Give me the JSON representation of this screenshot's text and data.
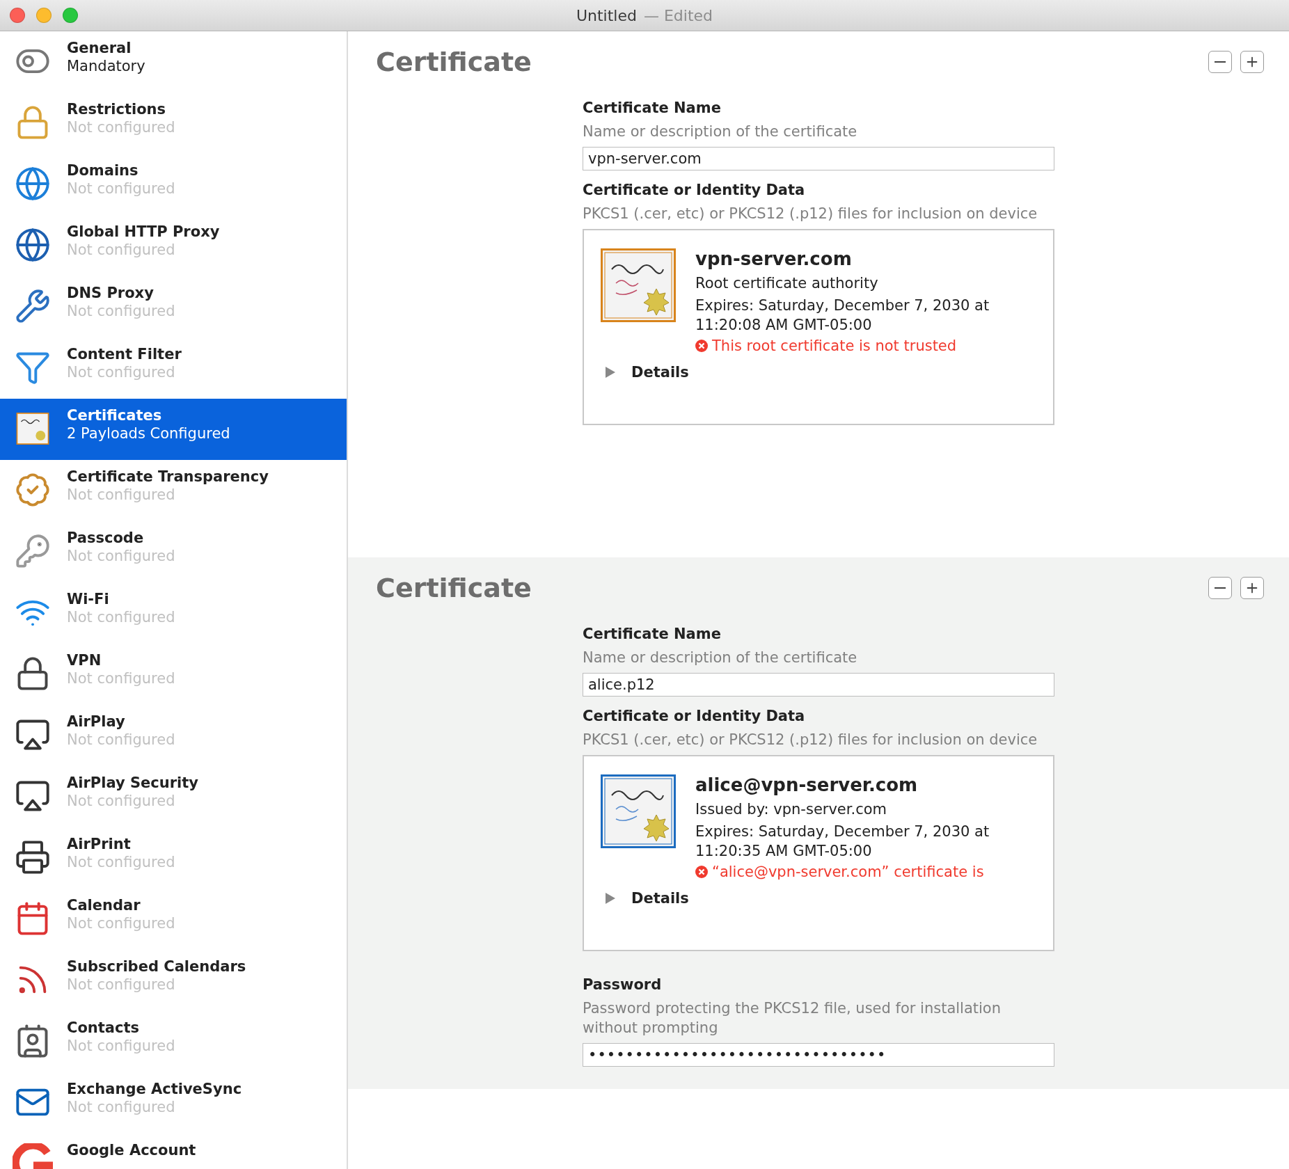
{
  "window": {
    "title": "Untitled",
    "status": "— Edited"
  },
  "sidebar": {
    "items": [
      {
        "title": "General",
        "subtitle": "Mandatory",
        "configured": true,
        "selected": false
      },
      {
        "title": "Restrictions",
        "subtitle": "Not configured",
        "configured": false,
        "selected": false
      },
      {
        "title": "Domains",
        "subtitle": "Not configured",
        "configured": false,
        "selected": false
      },
      {
        "title": "Global HTTP Proxy",
        "subtitle": "Not configured",
        "configured": false,
        "selected": false
      },
      {
        "title": "DNS Proxy",
        "subtitle": "Not configured",
        "configured": false,
        "selected": false
      },
      {
        "title": "Content Filter",
        "subtitle": "Not configured",
        "configured": false,
        "selected": false
      },
      {
        "title": "Certificates",
        "subtitle": "2 Payloads Configured",
        "configured": true,
        "selected": true
      },
      {
        "title": "Certificate Transparency",
        "subtitle": "Not configured",
        "configured": false,
        "selected": false
      },
      {
        "title": "Passcode",
        "subtitle": "Not configured",
        "configured": false,
        "selected": false
      },
      {
        "title": "Wi-Fi",
        "subtitle": "Not configured",
        "configured": false,
        "selected": false
      },
      {
        "title": "VPN",
        "subtitle": "Not configured",
        "configured": false,
        "selected": false
      },
      {
        "title": "AirPlay",
        "subtitle": "Not configured",
        "configured": false,
        "selected": false
      },
      {
        "title": "AirPlay Security",
        "subtitle": "Not configured",
        "configured": false,
        "selected": false
      },
      {
        "title": "AirPrint",
        "subtitle": "Not configured",
        "configured": false,
        "selected": false
      },
      {
        "title": "Calendar",
        "subtitle": "Not configured",
        "configured": false,
        "selected": false
      },
      {
        "title": "Subscribed Calendars",
        "subtitle": "Not configured",
        "configured": false,
        "selected": false
      },
      {
        "title": "Contacts",
        "subtitle": "Not configured",
        "configured": false,
        "selected": false
      },
      {
        "title": "Exchange ActiveSync",
        "subtitle": "Not configured",
        "configured": false,
        "selected": false
      },
      {
        "title": "Google Account",
        "selected": false
      }
    ]
  },
  "payloads": [
    {
      "heading": "Certificate",
      "shaded": false,
      "name_label": "Certificate Name",
      "name_hint": "Name or description of the certificate",
      "name_value": "vpn-server.com",
      "data_label": "Certificate or Identity Data",
      "data_hint": "PKCS1 (.cer, etc) or PKCS12 (.p12) files for inclusion on device",
      "certificate": {
        "kind": "root",
        "title": "vpn-server.com",
        "subtitle": "Root certificate authority",
        "expires": "Expires: Saturday, December 7, 2030 at 11:20:08 AM GMT-05:00",
        "error": "This root certificate is not trusted",
        "details": "Details",
        "expanded": false
      }
    },
    {
      "heading": "Certificate",
      "shaded": true,
      "name_label": "Certificate Name",
      "name_hint": "Name or description of the certificate",
      "name_value": "alice.p12",
      "data_label": "Certificate or Identity Data",
      "data_hint": "PKCS1 (.cer, etc) or PKCS12 (.p12) files for inclusion on device",
      "certificate": {
        "kind": "standard",
        "title": "alice@vpn-server.com",
        "subtitle": "Issued by: vpn-server.com",
        "expires": "Expires: Saturday, December 7, 2030 at 11:20:35 AM GMT-05:00",
        "error": "“alice@vpn-server.com” certificate is",
        "details": "Details",
        "expanded": false
      },
      "password": {
        "label": "Password",
        "hint": "Password protecting the PKCS12 file, used for installation without prompting",
        "value": "••••••••••••••••••••••••••••••••"
      }
    }
  ]
}
